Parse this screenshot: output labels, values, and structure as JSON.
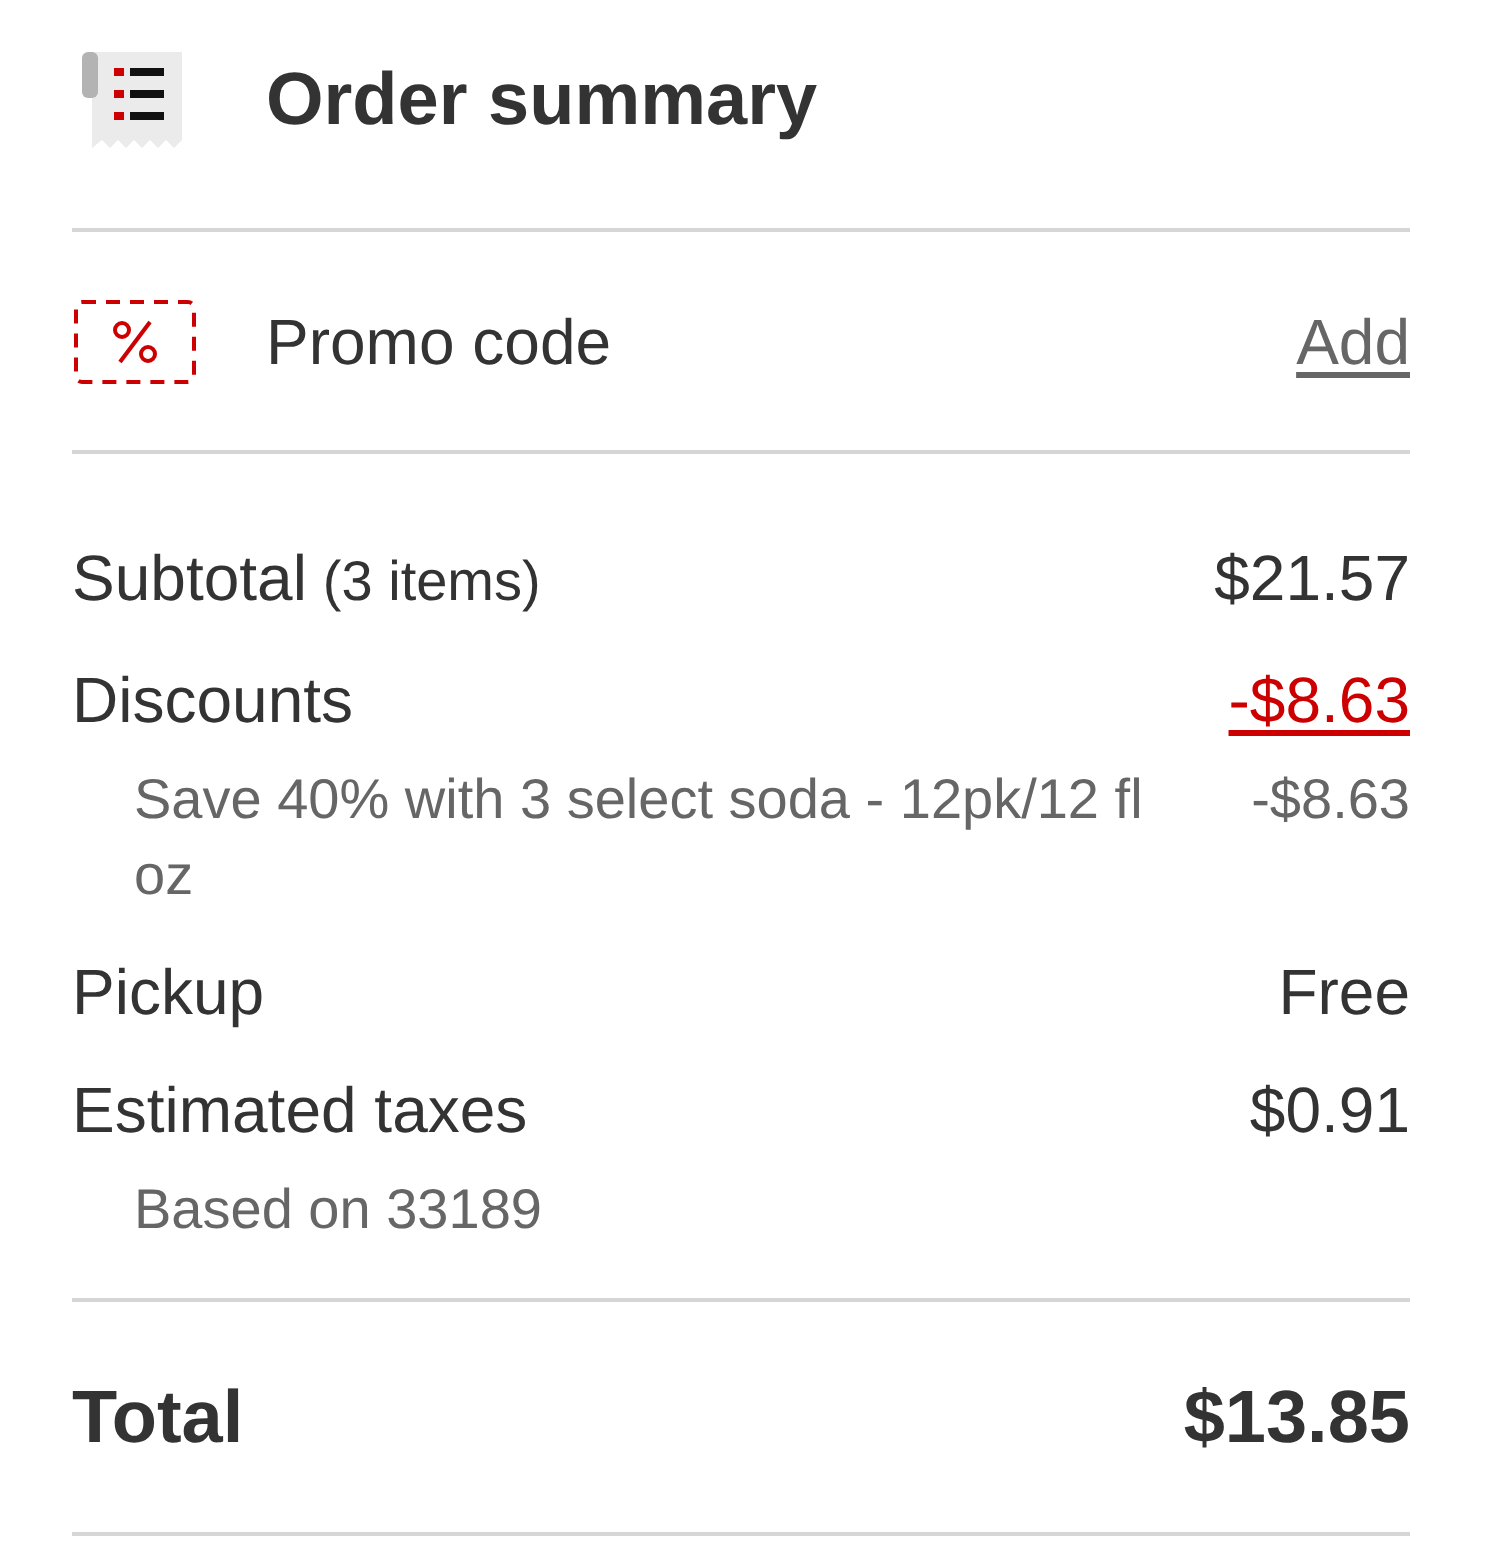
{
  "header": {
    "title": "Order summary"
  },
  "promo": {
    "label": "Promo code",
    "action": "Add"
  },
  "lines": [
    {
      "kind": "plain",
      "label": "Subtotal",
      "note": "(3 items)",
      "amount": "$21.57"
    },
    {
      "kind": "discount",
      "label": "Discounts",
      "amount": "-$8.63",
      "details": [
        {
          "text": "Save 40% with 3 select soda - 12pk/12 fl oz",
          "amount": "-$8.63"
        }
      ]
    },
    {
      "kind": "plain",
      "label": "Pickup",
      "amount": "Free"
    },
    {
      "kind": "plain",
      "label": "Estimated taxes",
      "amount": "$0.91",
      "details": [
        {
          "text": "Based on 33189"
        }
      ]
    }
  ],
  "total": {
    "label": "Total",
    "amount": "$13.85"
  }
}
